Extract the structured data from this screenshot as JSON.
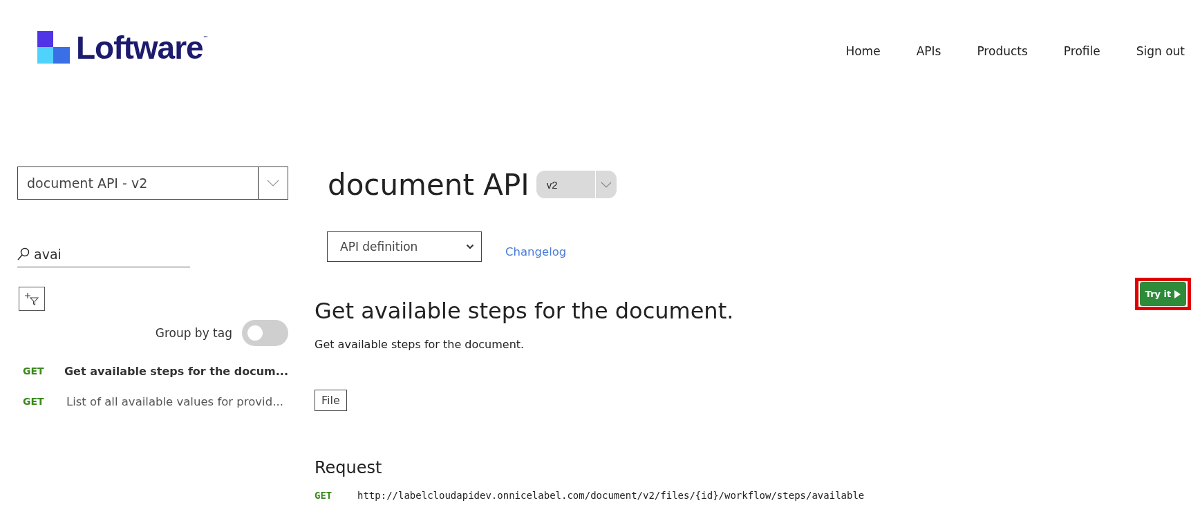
{
  "header": {
    "logo_text": "Loftware",
    "logo_tm": "™",
    "nav": [
      {
        "label": "Home"
      },
      {
        "label": "APIs"
      },
      {
        "label": "Products"
      },
      {
        "label": "Profile"
      },
      {
        "label": "Sign out"
      }
    ]
  },
  "sidebar": {
    "api_select": {
      "value": "document API - v2"
    },
    "search": {
      "value": "avai"
    },
    "group_by_tag": {
      "label": "Group by tag",
      "on": false
    },
    "operations": [
      {
        "method": "GET",
        "label": "Get available steps for the docum...",
        "selected": true
      },
      {
        "method": "GET",
        "label": "List of all available values for provid...",
        "selected": false
      }
    ]
  },
  "main": {
    "title": "document API",
    "version_select": {
      "value": "v2"
    },
    "definition_select": {
      "value": "API definition"
    },
    "changelog": "Changelog",
    "operation": {
      "title": "Get available steps for the document.",
      "description": "Get available steps for the document.",
      "tag": "File"
    },
    "request": {
      "heading": "Request",
      "method": "GET",
      "url": "http://labelcloudapidev.onnicelabel.com/document/v2/files/{id}/workflow/steps/available"
    },
    "try_it": {
      "label": "Try it",
      "highlighted": true
    }
  }
}
